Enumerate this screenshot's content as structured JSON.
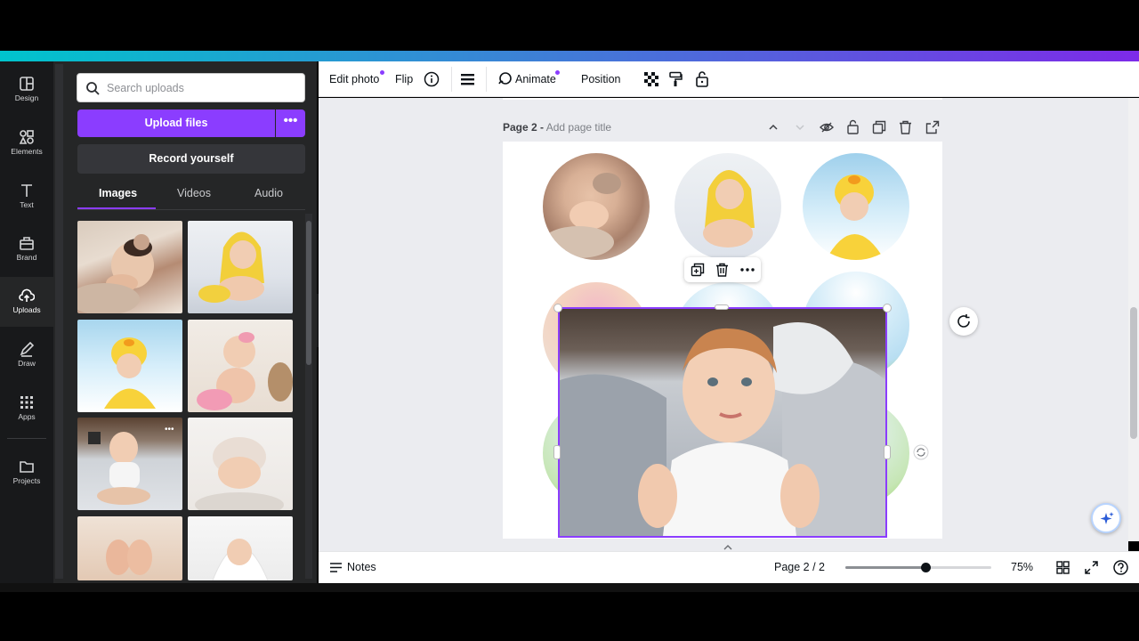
{
  "rail": {
    "items": [
      {
        "label": "Design",
        "icon": "design-icon"
      },
      {
        "label": "Elements",
        "icon": "elements-icon"
      },
      {
        "label": "Text",
        "icon": "text-icon"
      },
      {
        "label": "Brand",
        "icon": "brand-icon"
      },
      {
        "label": "Uploads",
        "icon": "upload-cloud-icon"
      },
      {
        "label": "Draw",
        "icon": "draw-icon"
      },
      {
        "label": "Apps",
        "icon": "apps-icon"
      },
      {
        "label": "Projects",
        "icon": "folder-icon"
      }
    ],
    "active": "Uploads"
  },
  "panel": {
    "search_placeholder": "Search uploads",
    "upload_label": "Upload files",
    "upload_more": "•••",
    "record_label": "Record yourself",
    "tabs": [
      "Images",
      "Videos",
      "Audio"
    ],
    "active_tab": "Images"
  },
  "toolbar": {
    "edit_photo": "Edit photo",
    "flip": "Flip",
    "animate": "Animate",
    "position": "Position"
  },
  "page": {
    "label": "Page 2 -",
    "title_placeholder": "Add page title"
  },
  "footer": {
    "notes": "Notes",
    "page_indicator": "Page 2 / 2",
    "zoom": "75%",
    "zoom_fraction": 0.55
  },
  "colors": {
    "accent": "#8b3dff",
    "panel_bg": "#252627",
    "rail_bg": "#18191b"
  }
}
